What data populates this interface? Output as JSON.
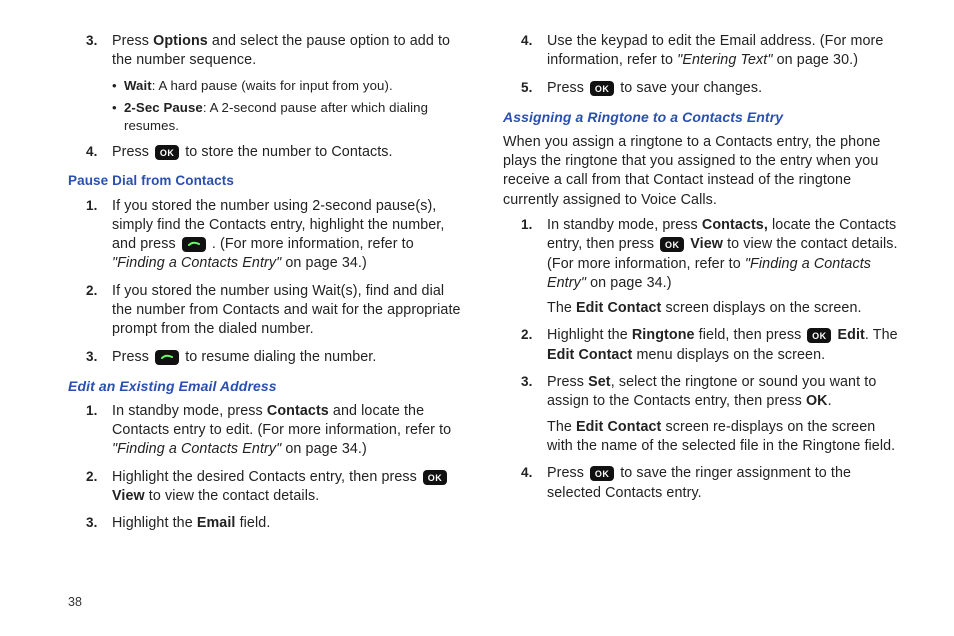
{
  "page_number": "38",
  "left": {
    "list_a": {
      "n3": {
        "marker": "3.",
        "pre": "Press ",
        "bold1": "Options",
        "post": " and select the pause option to add to the number sequence.",
        "bullets": [
          {
            "bold": "Wait",
            "rest": ": A hard pause (waits for input from you)."
          },
          {
            "bold": "2-Sec Pause",
            "rest": ": A 2-second pause after which dialing resumes."
          }
        ]
      },
      "n4": {
        "marker": "4.",
        "pre": "Press ",
        "post": " to store the number to Contacts."
      }
    },
    "heading_pause": "Pause Dial from Contacts",
    "list_b": {
      "n1": {
        "marker": "1.",
        "t1": "If you stored the number using 2-second pause(s), simply find the Contacts entry, highlight the number, and press ",
        "after_icon": " . (For more information, refer to ",
        "ref_i": "\"Finding a Contacts Entry\"",
        "ref_tail": "  on page 34.)"
      },
      "n2": {
        "marker": "2.",
        "t": "If you stored the number using Wait(s), find and dial the number from Contacts and wait for the appropriate prompt from the dialed number."
      },
      "n3": {
        "marker": "3.",
        "pre": "Press ",
        "post": " to resume dialing the number."
      }
    },
    "heading_email": "Edit an Existing Email Address",
    "list_c": {
      "n1": {
        "marker": "1.",
        "t1": "In standby mode, press ",
        "b1": "Contacts",
        "t2": " and locate the Contacts entry to edit. (For more information, refer to ",
        "ref_i": "\"Finding a Contacts Entry\"",
        "ref_tail": "  on page 34.)"
      },
      "n2": {
        "marker": "2.",
        "t1": "Highlight the desired Contacts entry, then press ",
        "b2": "View",
        "t2": " to view the contact details."
      },
      "n3": {
        "marker": "3.",
        "t1": "Highlight the ",
        "b1": "Email",
        "t2": " field."
      }
    }
  },
  "right": {
    "list_c_cont": {
      "n4": {
        "marker": "4.",
        "t1": "Use the keypad to edit the Email address. (For more information, refer to ",
        "ref_i": "\"Entering Text\"",
        "ref_tail": "  on page 30.)"
      },
      "n5": {
        "marker": "5.",
        "pre": "Press ",
        "post": " to save your changes."
      }
    },
    "heading_ring": "Assigning a Ringtone to a Contacts Entry",
    "intro": "When you assign a ringtone to a Contacts entry, the phone plays the ringtone that you assigned to the entry when you receive a call from that Contact instead of the ringtone currently assigned to Voice Calls.",
    "list_d": {
      "n1": {
        "marker": "1.",
        "t1": "In standby mode, press ",
        "b1": "Contacts,",
        "t2": " locate the Contacts entry, then press ",
        "b2": "View",
        "t3": " to view the contact details. (For more information, refer to ",
        "ref_i": "\"Finding a Contacts Entry\"",
        "ref_tail": "  on page 34.)",
        "cont_pre": "The ",
        "cont_b": "Edit Contact",
        "cont_post": " screen displays on the screen."
      },
      "n2": {
        "marker": "2.",
        "t1": "Highlight the ",
        "b1": "Ringtone",
        "t2": " field, then press ",
        "b2": "Edit",
        "t3": ". The ",
        "b3": "Edit Contact",
        "t4": " menu displays on the screen."
      },
      "n3": {
        "marker": "3.",
        "t1": "Press ",
        "b1": "Set",
        "t2": ", select the ringtone or sound you want to assign to the Contacts entry, then press ",
        "b2": "OK",
        "t3": ".",
        "cont_pre": "The ",
        "cont_b": "Edit Contact",
        "cont_post": " screen re-displays on the screen with the name of the selected file in the Ringtone field."
      },
      "n4": {
        "marker": "4.",
        "pre": "Press ",
        "post": " to save the ringer assignment to the selected Contacts entry."
      }
    }
  }
}
